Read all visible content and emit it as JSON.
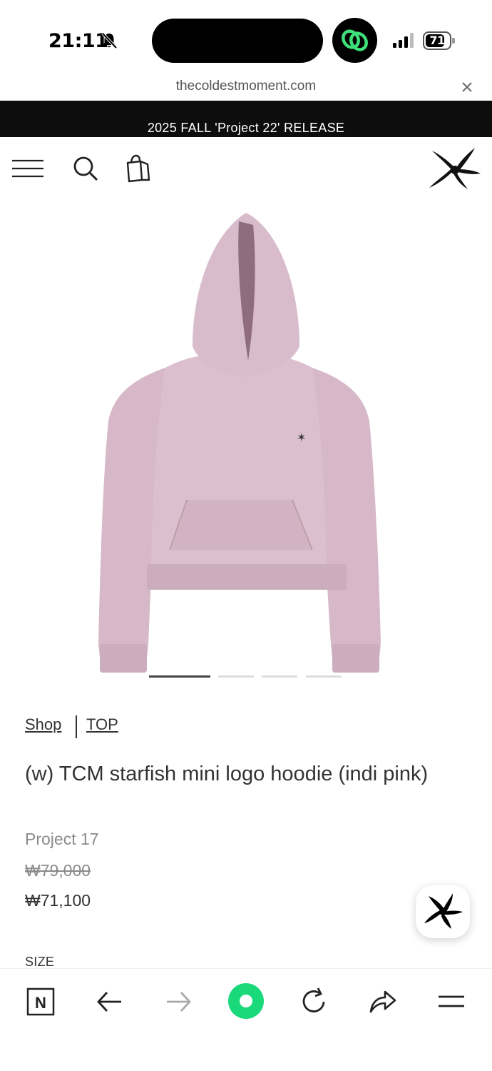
{
  "status_bar": {
    "time": "21:11",
    "battery": "71"
  },
  "browser": {
    "url": "thecoldestmoment.com"
  },
  "announcement": {
    "text": "2025 FALL 'Project 22' RELEASE"
  },
  "breadcrumb": {
    "items": [
      "Shop",
      "TOP"
    ]
  },
  "product": {
    "title": "(w) TCM starfish mini logo hoodie (indi pink)",
    "collection": "Project 17",
    "original_price": "₩79,000",
    "sale_price": "₩71,100",
    "size_label": "SIZE",
    "color": "#d9bccb"
  },
  "carousel": {
    "total": 4,
    "active": 1
  },
  "icons": {
    "status": [
      "bell-slash-icon",
      "app-link-icon",
      "signal-icon",
      "battery-icon"
    ],
    "header": [
      "menu-icon",
      "search-icon",
      "shopping-bag-icon",
      "starfish-logo-icon"
    ],
    "toolbar": [
      "naver-home-icon",
      "back-arrow-icon",
      "forward-arrow-icon",
      "green-dot-icon",
      "reload-icon",
      "share-icon",
      "browser-menu-icon"
    ]
  }
}
